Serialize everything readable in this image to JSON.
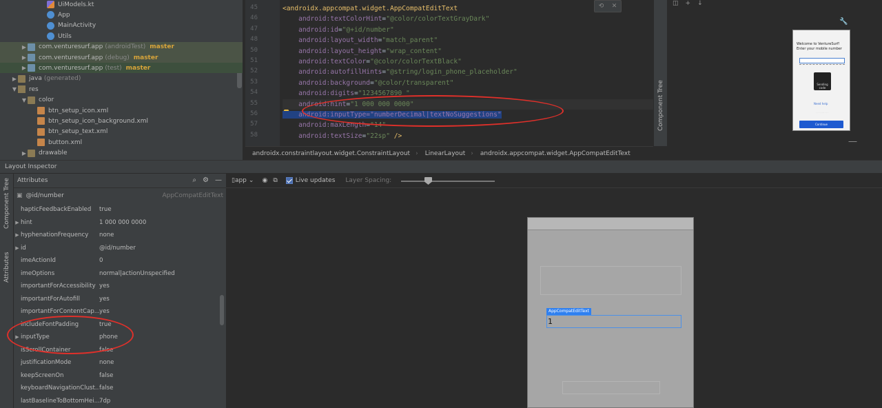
{
  "project_tree": {
    "items": [
      {
        "label": "UiModels.kt",
        "icon": "kotlin-file-icon",
        "indent": 4,
        "arrow": ""
      },
      {
        "label": "App",
        "icon": "app-class-icon",
        "indent": 4,
        "arrow": ""
      },
      {
        "label": "MainActivity",
        "icon": "app-class-icon",
        "indent": 4,
        "arrow": ""
      },
      {
        "label": "Utils",
        "icon": "app-class-icon",
        "indent": 4,
        "arrow": ""
      },
      {
        "label": "com.venturesurf.app",
        "suffix": "(androidTest)",
        "branch": "master",
        "icon": "package-icon",
        "indent": 2,
        "arrow": "▶"
      },
      {
        "label": "com.venturesurf.app",
        "suffix": "(debug)",
        "branch": "master",
        "icon": "package-icon",
        "indent": 2,
        "arrow": "▶"
      },
      {
        "label": "com.venturesurf.app",
        "suffix": "(test)",
        "branch": "master",
        "icon": "package-icon",
        "indent": 2,
        "arrow": "▶"
      },
      {
        "label": "java",
        "suffix": "(generated)",
        "icon": "folder-icon",
        "indent": 1,
        "arrow": "▶"
      },
      {
        "label": "res",
        "icon": "res-folder-icon",
        "indent": 1,
        "arrow": "▼"
      },
      {
        "label": "color",
        "icon": "folder-icon",
        "indent": 2,
        "arrow": "▼"
      },
      {
        "label": "btn_setup_icon.xml",
        "icon": "xml-file-icon",
        "indent": 3,
        "arrow": ""
      },
      {
        "label": "btn_setup_icon_background.xml",
        "icon": "xml-file-icon",
        "indent": 3,
        "arrow": ""
      },
      {
        "label": "btn_setup_text.xml",
        "icon": "xml-file-icon",
        "indent": 3,
        "arrow": ""
      },
      {
        "label": "button.xml",
        "icon": "xml-file-icon",
        "indent": 3,
        "arrow": ""
      },
      {
        "label": "drawable",
        "icon": "folder-icon",
        "indent": 2,
        "arrow": "▶"
      }
    ]
  },
  "editor": {
    "line_numbers": [
      "45",
      "46",
      "47",
      "48",
      "50",
      "51",
      "52",
      "53",
      "54",
      "55",
      "56",
      "57",
      "58"
    ],
    "lines": [
      [
        {
          "t": "<androidx.appcompat.widget.AppCompatEditText",
          "c": "tag"
        }
      ],
      [
        {
          "t": "    android:",
          "c": "attr"
        },
        {
          "t": "textColorHint",
          "c": "attr"
        },
        {
          "t": "=",
          "c": ""
        },
        {
          "t": "\"@color/colorTextGrayDark\"",
          "c": "val"
        }
      ],
      [
        {
          "t": "    android:",
          "c": "attr"
        },
        {
          "t": "id",
          "c": "attr"
        },
        {
          "t": "=",
          "c": ""
        },
        {
          "t": "\"@+id/number\"",
          "c": "val"
        }
      ],
      [
        {
          "t": "    android:",
          "c": "attr"
        },
        {
          "t": "layout_width",
          "c": "attr"
        },
        {
          "t": "=",
          "c": ""
        },
        {
          "t": "\"match_parent\"",
          "c": "val"
        }
      ],
      [
        {
          "t": "    android:",
          "c": "attr"
        },
        {
          "t": "layout_height",
          "c": "attr"
        },
        {
          "t": "=",
          "c": ""
        },
        {
          "t": "\"wrap_content\"",
          "c": "val"
        }
      ],
      [
        {
          "t": "    android:",
          "c": "attr"
        },
        {
          "t": "textColor",
          "c": "attr"
        },
        {
          "t": "=",
          "c": ""
        },
        {
          "t": "\"@color/colorTextBlack\"",
          "c": "val"
        }
      ],
      [
        {
          "t": "    android:",
          "c": "attr"
        },
        {
          "t": "autofillHints",
          "c": "attr"
        },
        {
          "t": "=",
          "c": ""
        },
        {
          "t": "\"@string/login_phone_placeholder\"",
          "c": "val"
        }
      ],
      [
        {
          "t": "    android:",
          "c": "attr"
        },
        {
          "t": "background",
          "c": "attr"
        },
        {
          "t": "=",
          "c": ""
        },
        {
          "t": "\"@color/transparent\"",
          "c": "val"
        }
      ],
      [
        {
          "t": "    android:",
          "c": "attr"
        },
        {
          "t": "digits",
          "c": "attr"
        },
        {
          "t": "=",
          "c": ""
        },
        {
          "t": "\"1234567890 \"",
          "c": "val"
        }
      ],
      [
        {
          "t": "    android:",
          "c": "attr"
        },
        {
          "t": "hint",
          "c": "attr"
        },
        {
          "t": "=",
          "c": ""
        },
        {
          "t": "\"1 000 000 0000\"",
          "c": "val"
        }
      ],
      [
        {
          "t": "    android:inputType=\"numberDecimal|textNoSuggestions\"",
          "c": "sel"
        }
      ],
      [
        {
          "t": "    android:",
          "c": "attr"
        },
        {
          "t": "maxLength",
          "c": "attr"
        },
        {
          "t": "=",
          "c": ""
        },
        {
          "t": "\"14\"",
          "c": "val"
        }
      ],
      [
        {
          "t": "    android:",
          "c": "attr"
        },
        {
          "t": "textSize",
          "c": "attr"
        },
        {
          "t": "=",
          "c": ""
        },
        {
          "t": "\"22sp\"",
          "c": "val"
        },
        {
          "t": " />",
          "c": "tag"
        }
      ]
    ],
    "breadcrumb": [
      "androidx.constraintlayout.widget.ConstraintLayout",
      "LinearLayout",
      "androidx.appcompat.widget.AppCompatEditText"
    ]
  },
  "preview": {
    "side_tab": "Component Tree",
    "phone": {
      "welcome": "Welcome to VentureSurf!",
      "prompt": "Enter your mobile number",
      "spinner_text": "Sending code",
      "link": "Need help",
      "continue": "Continue"
    }
  },
  "layout_inspector": {
    "title": "Layout Inspector",
    "side_tabs": [
      "Component Tree",
      "Attributes"
    ],
    "attributes_title": "Attributes",
    "selected_id": "@id/number",
    "selected_class": "AppCompatEditText",
    "rows": [
      {
        "key": "hapticFeedbackEnabled",
        "value": "true",
        "expandable": false
      },
      {
        "key": "hint",
        "value": "1 000 000 0000",
        "expandable": true
      },
      {
        "key": "hyphenationFrequency",
        "value": "none",
        "expandable": true
      },
      {
        "key": "id",
        "value": "@id/number",
        "expandable": true
      },
      {
        "key": "imeActionId",
        "value": "0",
        "expandable": false
      },
      {
        "key": "imeOptions",
        "value": "normal|actionUnspecified",
        "expandable": false
      },
      {
        "key": "importantForAccessibility",
        "value": "yes",
        "expandable": false
      },
      {
        "key": "importantForAutofill",
        "value": "yes",
        "expandable": false
      },
      {
        "key": "importantForContentCap...",
        "value": "yes",
        "expandable": false
      },
      {
        "key": "includeFontPadding",
        "value": "true",
        "expandable": false
      },
      {
        "key": "inputType",
        "value": "phone",
        "expandable": true
      },
      {
        "key": "isScrollContainer",
        "value": "false",
        "expandable": false
      },
      {
        "key": "justificationMode",
        "value": "none",
        "expandable": false
      },
      {
        "key": "keepScreenOn",
        "value": "false",
        "expandable": false
      },
      {
        "key": "keyboardNavigationClust...",
        "value": "false",
        "expandable": false
      },
      {
        "key": "lastBaselineToBottomHei...",
        "value": "7dp",
        "expandable": false
      }
    ],
    "toolbar": {
      "process": "app",
      "live_updates": "Live updates",
      "layer_spacing": "Layer Spacing:"
    },
    "device": {
      "selected_label": "AppCompatEditText",
      "edit_value": "1"
    }
  },
  "colors": {
    "annotation": "#e0302a",
    "selection": "#214283",
    "branch": "#d9a53a"
  }
}
